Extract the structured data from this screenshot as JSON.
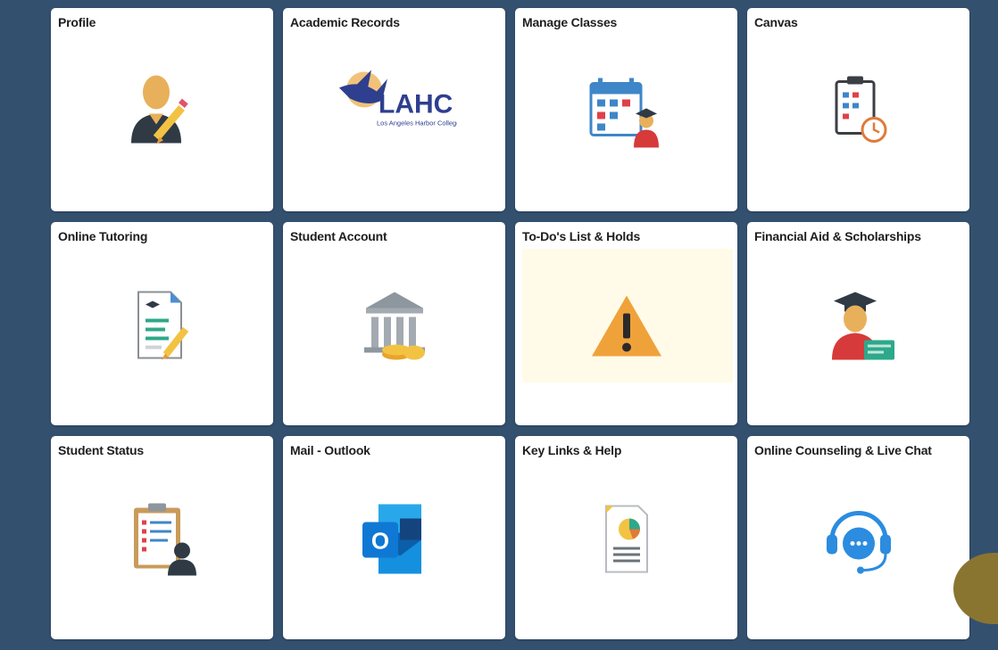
{
  "tiles": [
    {
      "title": "Profile",
      "icon": "profile-icon"
    },
    {
      "title": "Academic Records",
      "icon": "lahc-logo-icon",
      "logo_text": "LAHC",
      "logo_sub": "Los Angeles Harbor College"
    },
    {
      "title": "Manage Classes",
      "icon": "calendar-student-icon"
    },
    {
      "title": "Canvas",
      "icon": "clipboard-clock-icon"
    },
    {
      "title": "Online Tutoring",
      "icon": "document-pencil-icon"
    },
    {
      "title": "Student Account",
      "icon": "bank-coins-icon"
    },
    {
      "title": "To-Do's List & Holds",
      "icon": "warning-icon"
    },
    {
      "title": "Financial Aid & Scholarships",
      "icon": "graduate-money-icon"
    },
    {
      "title": "Student Status",
      "icon": "clipboard-person-icon"
    },
    {
      "title": "Mail - Outlook",
      "icon": "outlook-icon",
      "logo_letter": "O"
    },
    {
      "title": "Key Links & Help",
      "icon": "report-pie-icon"
    },
    {
      "title": "Online Counseling & Live Chat",
      "icon": "headset-chat-icon"
    }
  ],
  "colors": {
    "background": "#33506f",
    "tile": "#ffffff",
    "warning": "#f0a23a",
    "accent": "#8a7530"
  }
}
